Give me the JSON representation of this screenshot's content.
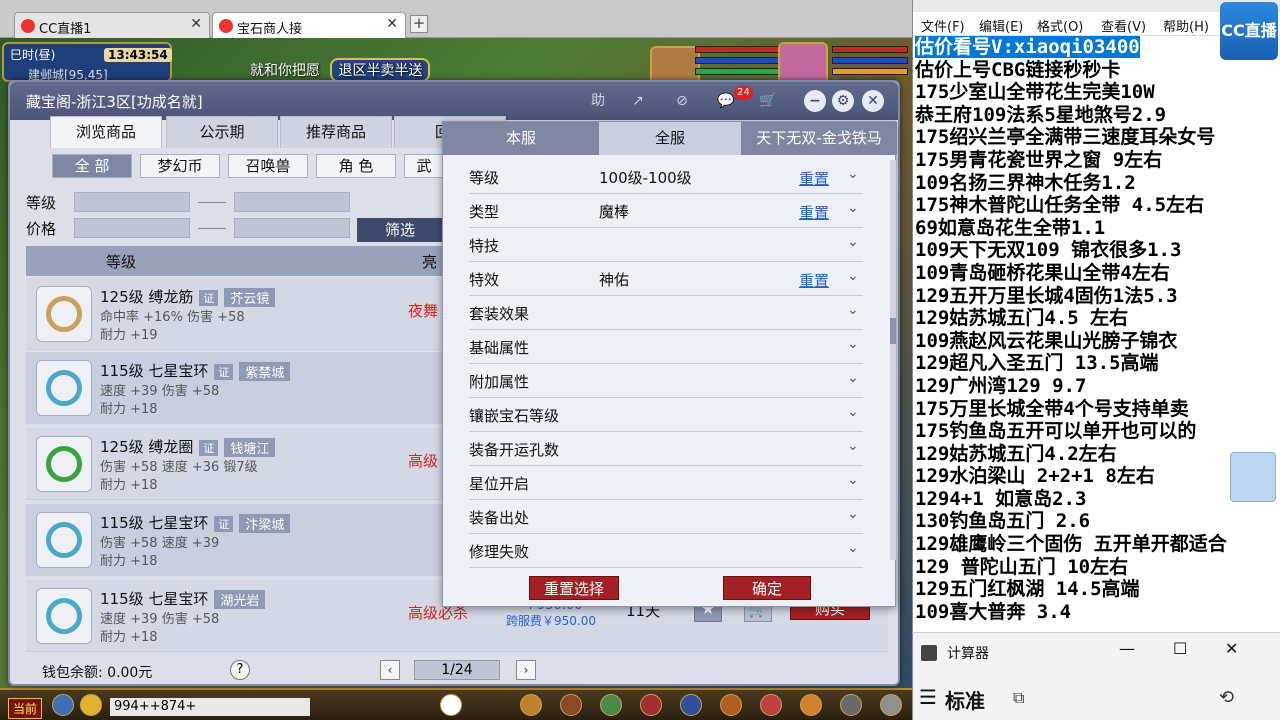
{
  "browser": {
    "tabs": [
      {
        "title": "CC直播1"
      },
      {
        "title": "宝石商人接"
      }
    ],
    "new_tab": "+"
  },
  "game": {
    "clock_label": "巳时(昼)",
    "clock_time": "13:43:54",
    "location": "建邺城[95,45]",
    "banner_text": "就和你把愿",
    "banner_pill": "退区半卖半送",
    "chat_text": "994++874+",
    "current_channel": "当前"
  },
  "market": {
    "title": "藏宝阁-浙江3区[功成名就]",
    "header_icons": {
      "help": "助",
      "share": "↗",
      "stop": "⊘",
      "chat": "💬",
      "cart": "🛒"
    },
    "chat_badge": "24",
    "tabs": [
      "浏览商品",
      "公示期",
      "推荐商品",
      "回流"
    ],
    "categories": [
      "全 部",
      "梦幻币",
      "召唤兽",
      "角 色",
      "武"
    ],
    "filter": {
      "level_label": "等级",
      "price_label": "价格",
      "button": "筛选"
    },
    "columns": {
      "level": "等级",
      "highlight": "亮"
    },
    "items": [
      {
        "name": "125级  缚龙筋",
        "tag": "证",
        "server": "芥云镜",
        "stat1": "命中率 +16%  伤害 +58",
        "stat2": "耐力 +19",
        "highlight": "夜舞",
        "ring_color": "#c9a15a"
      },
      {
        "name": "115级  七星宝环",
        "tag": "证",
        "server": "紫禁城",
        "stat1": "速度 +39  伤害 +58",
        "stat2": "耐力 +18",
        "highlight": "",
        "ring_color": "#4aa8c8"
      },
      {
        "name": "125级  缚龙圈",
        "tag": "证",
        "server": "钱塘江",
        "stat1": "伤害 +58  速度 +36  锻7级",
        "stat2": "耐力 +18",
        "highlight": "高级",
        "ring_color": "#3aa040"
      },
      {
        "name": "115级  七星宝环",
        "tag": "证",
        "server": "汴梁城",
        "stat1": "伤害 +58  速度 +39",
        "stat2": "耐力 +18",
        "highlight": "",
        "ring_color": "#4aa8c8"
      },
      {
        "name": "115级  七星宝环",
        "tag": "证",
        "server": "湖光岩",
        "stat1": "速度 +39  伤害 +58",
        "stat2": "耐力 +18",
        "highlight": "高级必杀",
        "price": "￥950.00",
        "cross_price": "跨服费￥950.00",
        "days": "11天",
        "star_badge": "3",
        "buy": "购买",
        "ring_color": "#4aa8c8"
      }
    ],
    "wallet": "钱包余额: 0.00元",
    "help": "?",
    "page": "1/24",
    "prev": "‹",
    "next": "›"
  },
  "popup": {
    "tabs": [
      "本服",
      "全服",
      "天下无双-金戈铁马"
    ],
    "rows": [
      {
        "key": "等级",
        "value": "100级-100级",
        "reset": "重置"
      },
      {
        "key": "类型",
        "value": "魔棒",
        "reset": "重置"
      },
      {
        "key": "特技",
        "value": "",
        "reset": ""
      },
      {
        "key": "特效",
        "value": "神佑",
        "reset": "重置"
      },
      {
        "key": "套装效果",
        "value": "",
        "reset": ""
      },
      {
        "key": "基础属性",
        "value": "",
        "reset": ""
      },
      {
        "key": "附加属性",
        "value": "",
        "reset": ""
      },
      {
        "key": "镶嵌宝石等级",
        "value": "",
        "reset": ""
      },
      {
        "key": "装备开运孔数",
        "value": "",
        "reset": ""
      },
      {
        "key": "星位开启",
        "value": "",
        "reset": ""
      },
      {
        "key": "装备出处",
        "value": "",
        "reset": ""
      },
      {
        "key": "修理失败",
        "value": "",
        "reset": ""
      }
    ],
    "reset_button": "重置选择",
    "confirm_button": "确定"
  },
  "notepad": {
    "menu": [
      "文件(F)",
      "编辑(E)",
      "格式(O)",
      "查看(V)",
      "帮助(H)"
    ],
    "lines": [
      "估价看号V:xiaoqi03400",
      "估价上号CBG链接秒秒卡",
      "175少室山全带花生完美10W",
      "恭王府109法系5星地煞号2.9",
      "175绍兴兰亭全满带三速度耳朵女号",
      "175男青花瓷世界之窗  9左右",
      "109名扬三界神木任务1.2",
      "175神木普陀山任务全带 4.5左右",
      "69如意岛花生全带1.1",
      "109天下无双109  锦衣很多1.3",
      "109青岛砸桥花果山全带4左右",
      "129五开万里长城4固伤1法5.3",
      "129姑苏城五门4.5 左右",
      "109燕赵风云花果山光膀子锦衣",
      "129超凡入圣五门  13.5高端",
      "129广州湾129 9.7",
      "175万里长城全带4个号支持单卖",
      "175钓鱼岛五开可以单开也可以的",
      "129姑苏城五门4.2左右",
      "129水泊梁山 2+2+1 8左右",
      "1294+1 如意岛2.3",
      "130钓鱼岛五门  2.6",
      "129雄鹰岭三个固伤 五开单开都适合",
      "129 普陀山五门  10左右",
      "129五门红枫湖 14.5高端",
      "109喜大普奔  3.4"
    ]
  },
  "calculator": {
    "title": "计算器",
    "mode": "标准",
    "controls": {
      "minimize": "—",
      "maximize": "☐",
      "close": "✕"
    }
  },
  "logo_text": "CC直播"
}
